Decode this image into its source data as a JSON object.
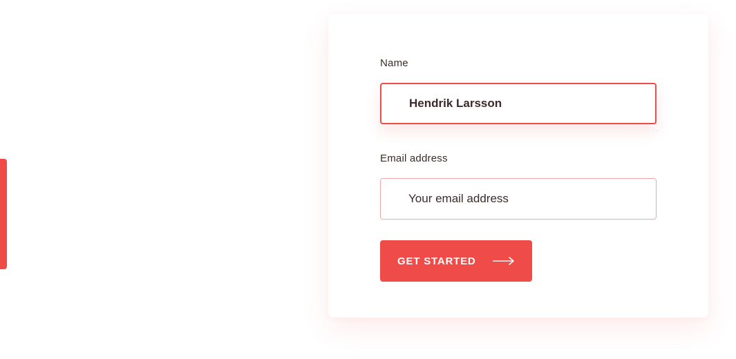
{
  "form": {
    "name": {
      "label": "Name",
      "value": "Hendrik Larsson"
    },
    "email": {
      "label": "Email address",
      "placeholder": "Your email address",
      "value": ""
    },
    "submit": {
      "label": "GET STARTED",
      "icon": "arrow-right-icon"
    }
  },
  "colors": {
    "accent": "#ef4b48",
    "text": "#3a2b2a",
    "email_border": "#f0a7a3",
    "background": "#ffffff"
  }
}
